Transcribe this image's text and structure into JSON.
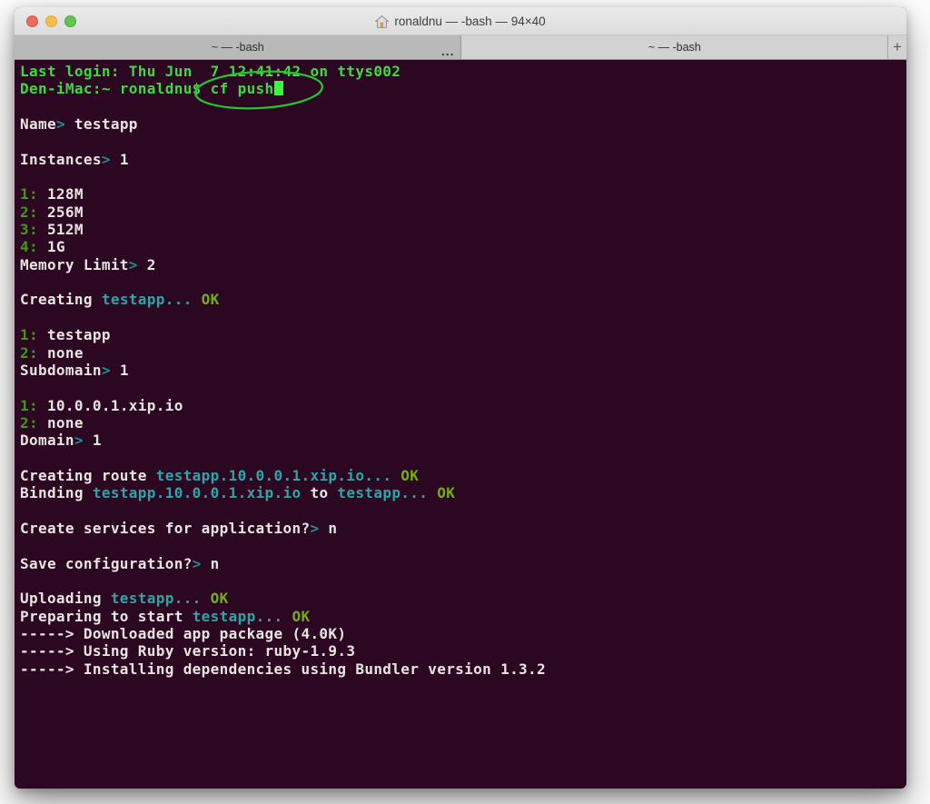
{
  "colors": {
    "terminal_bg": "#2c0722",
    "text_default": "#e9e5e0",
    "text_green": "#3bdc3b",
    "text_cyan": "#2aa6a7",
    "text_arrow": "#1f8e8f",
    "text_list_num": "#3f9b10",
    "text_ok": "#74ad18",
    "cursor_green": "#3ef53e",
    "annotation_green": "#23c62e"
  },
  "window": {
    "title": "ronaldnu — -bash — 94×40",
    "title_icon": "home-icon",
    "traffic_lights": [
      "close",
      "minimize",
      "zoom"
    ],
    "tabs": [
      {
        "label": "~ — -bash",
        "active": true,
        "overflow_label": "..."
      },
      {
        "label": "~ — -bash",
        "active": false
      }
    ],
    "new_tab_label": "+"
  },
  "annotation": {
    "shape": "hand-drawn-ellipse",
    "highlights_text": "cf push"
  },
  "terminal": {
    "lines": [
      {
        "segments": [
          {
            "t": "Last login: Thu Jun  7 12:41:42 on ttys002",
            "c": "green"
          }
        ]
      },
      {
        "segments": [
          {
            "t": "Den-iMac:~ ronaldnu$ cf push",
            "c": "green"
          },
          {
            "t": "",
            "c": "cursor"
          }
        ]
      },
      {
        "segments": []
      },
      {
        "segments": [
          {
            "t": "Name",
            "c": "default"
          },
          {
            "t": ">",
            "c": "arrow"
          },
          {
            "t": " testapp",
            "c": "default"
          }
        ]
      },
      {
        "segments": []
      },
      {
        "segments": [
          {
            "t": "Instances",
            "c": "default"
          },
          {
            "t": ">",
            "c": "arrow"
          },
          {
            "t": " 1",
            "c": "default"
          }
        ]
      },
      {
        "segments": []
      },
      {
        "segments": [
          {
            "t": "1:",
            "c": "num"
          },
          {
            "t": " 128M",
            "c": "default"
          }
        ]
      },
      {
        "segments": [
          {
            "t": "2:",
            "c": "num"
          },
          {
            "t": " 256M",
            "c": "default"
          }
        ]
      },
      {
        "segments": [
          {
            "t": "3:",
            "c": "num"
          },
          {
            "t": " 512M",
            "c": "default"
          }
        ]
      },
      {
        "segments": [
          {
            "t": "4:",
            "c": "num"
          },
          {
            "t": " 1G",
            "c": "default"
          }
        ]
      },
      {
        "segments": [
          {
            "t": "Memory Limit",
            "c": "default"
          },
          {
            "t": ">",
            "c": "arrow"
          },
          {
            "t": " 2",
            "c": "default"
          }
        ]
      },
      {
        "segments": []
      },
      {
        "segments": [
          {
            "t": "Creating ",
            "c": "default"
          },
          {
            "t": "testapp...",
            "c": "cyan"
          },
          {
            "t": " ",
            "c": "default"
          },
          {
            "t": "OK",
            "c": "ok"
          }
        ]
      },
      {
        "segments": []
      },
      {
        "segments": [
          {
            "t": "1:",
            "c": "num"
          },
          {
            "t": " testapp",
            "c": "default"
          }
        ]
      },
      {
        "segments": [
          {
            "t": "2:",
            "c": "num"
          },
          {
            "t": " none",
            "c": "default"
          }
        ]
      },
      {
        "segments": [
          {
            "t": "Subdomain",
            "c": "default"
          },
          {
            "t": ">",
            "c": "arrow"
          },
          {
            "t": " 1",
            "c": "default"
          }
        ]
      },
      {
        "segments": []
      },
      {
        "segments": [
          {
            "t": "1:",
            "c": "num"
          },
          {
            "t": " 10.0.0.1.xip.io",
            "c": "default"
          }
        ]
      },
      {
        "segments": [
          {
            "t": "2:",
            "c": "num"
          },
          {
            "t": " none",
            "c": "default"
          }
        ]
      },
      {
        "segments": [
          {
            "t": "Domain",
            "c": "default"
          },
          {
            "t": ">",
            "c": "arrow"
          },
          {
            "t": " 1",
            "c": "default"
          }
        ]
      },
      {
        "segments": []
      },
      {
        "segments": [
          {
            "t": "Creating route ",
            "c": "default"
          },
          {
            "t": "testapp.10.0.0.1.xip.io...",
            "c": "cyan"
          },
          {
            "t": " ",
            "c": "default"
          },
          {
            "t": "OK",
            "c": "ok"
          }
        ]
      },
      {
        "segments": [
          {
            "t": "Binding ",
            "c": "default"
          },
          {
            "t": "testapp.10.0.0.1.xip.io",
            "c": "cyan"
          },
          {
            "t": " to ",
            "c": "default"
          },
          {
            "t": "testapp...",
            "c": "cyan"
          },
          {
            "t": " ",
            "c": "default"
          },
          {
            "t": "OK",
            "c": "ok"
          }
        ]
      },
      {
        "segments": []
      },
      {
        "segments": [
          {
            "t": "Create services for application?",
            "c": "default"
          },
          {
            "t": ">",
            "c": "arrow"
          },
          {
            "t": " n",
            "c": "default"
          }
        ]
      },
      {
        "segments": []
      },
      {
        "segments": [
          {
            "t": "Save configuration?",
            "c": "default"
          },
          {
            "t": ">",
            "c": "arrow"
          },
          {
            "t": " n",
            "c": "default"
          }
        ]
      },
      {
        "segments": []
      },
      {
        "segments": [
          {
            "t": "Uploading ",
            "c": "default"
          },
          {
            "t": "testapp...",
            "c": "cyan"
          },
          {
            "t": " ",
            "c": "default"
          },
          {
            "t": "OK",
            "c": "ok"
          }
        ]
      },
      {
        "segments": [
          {
            "t": "Preparing to start ",
            "c": "default"
          },
          {
            "t": "testapp...",
            "c": "cyan"
          },
          {
            "t": " ",
            "c": "default"
          },
          {
            "t": "OK",
            "c": "ok"
          }
        ]
      },
      {
        "segments": [
          {
            "t": "-----> Downloaded app package (4.0K)",
            "c": "default"
          }
        ]
      },
      {
        "segments": [
          {
            "t": "-----> Using Ruby version: ruby-1.9.3",
            "c": "default"
          }
        ]
      },
      {
        "segments": [
          {
            "t": "-----> Installing dependencies using Bundler version 1.3.2",
            "c": "default"
          }
        ]
      }
    ]
  }
}
